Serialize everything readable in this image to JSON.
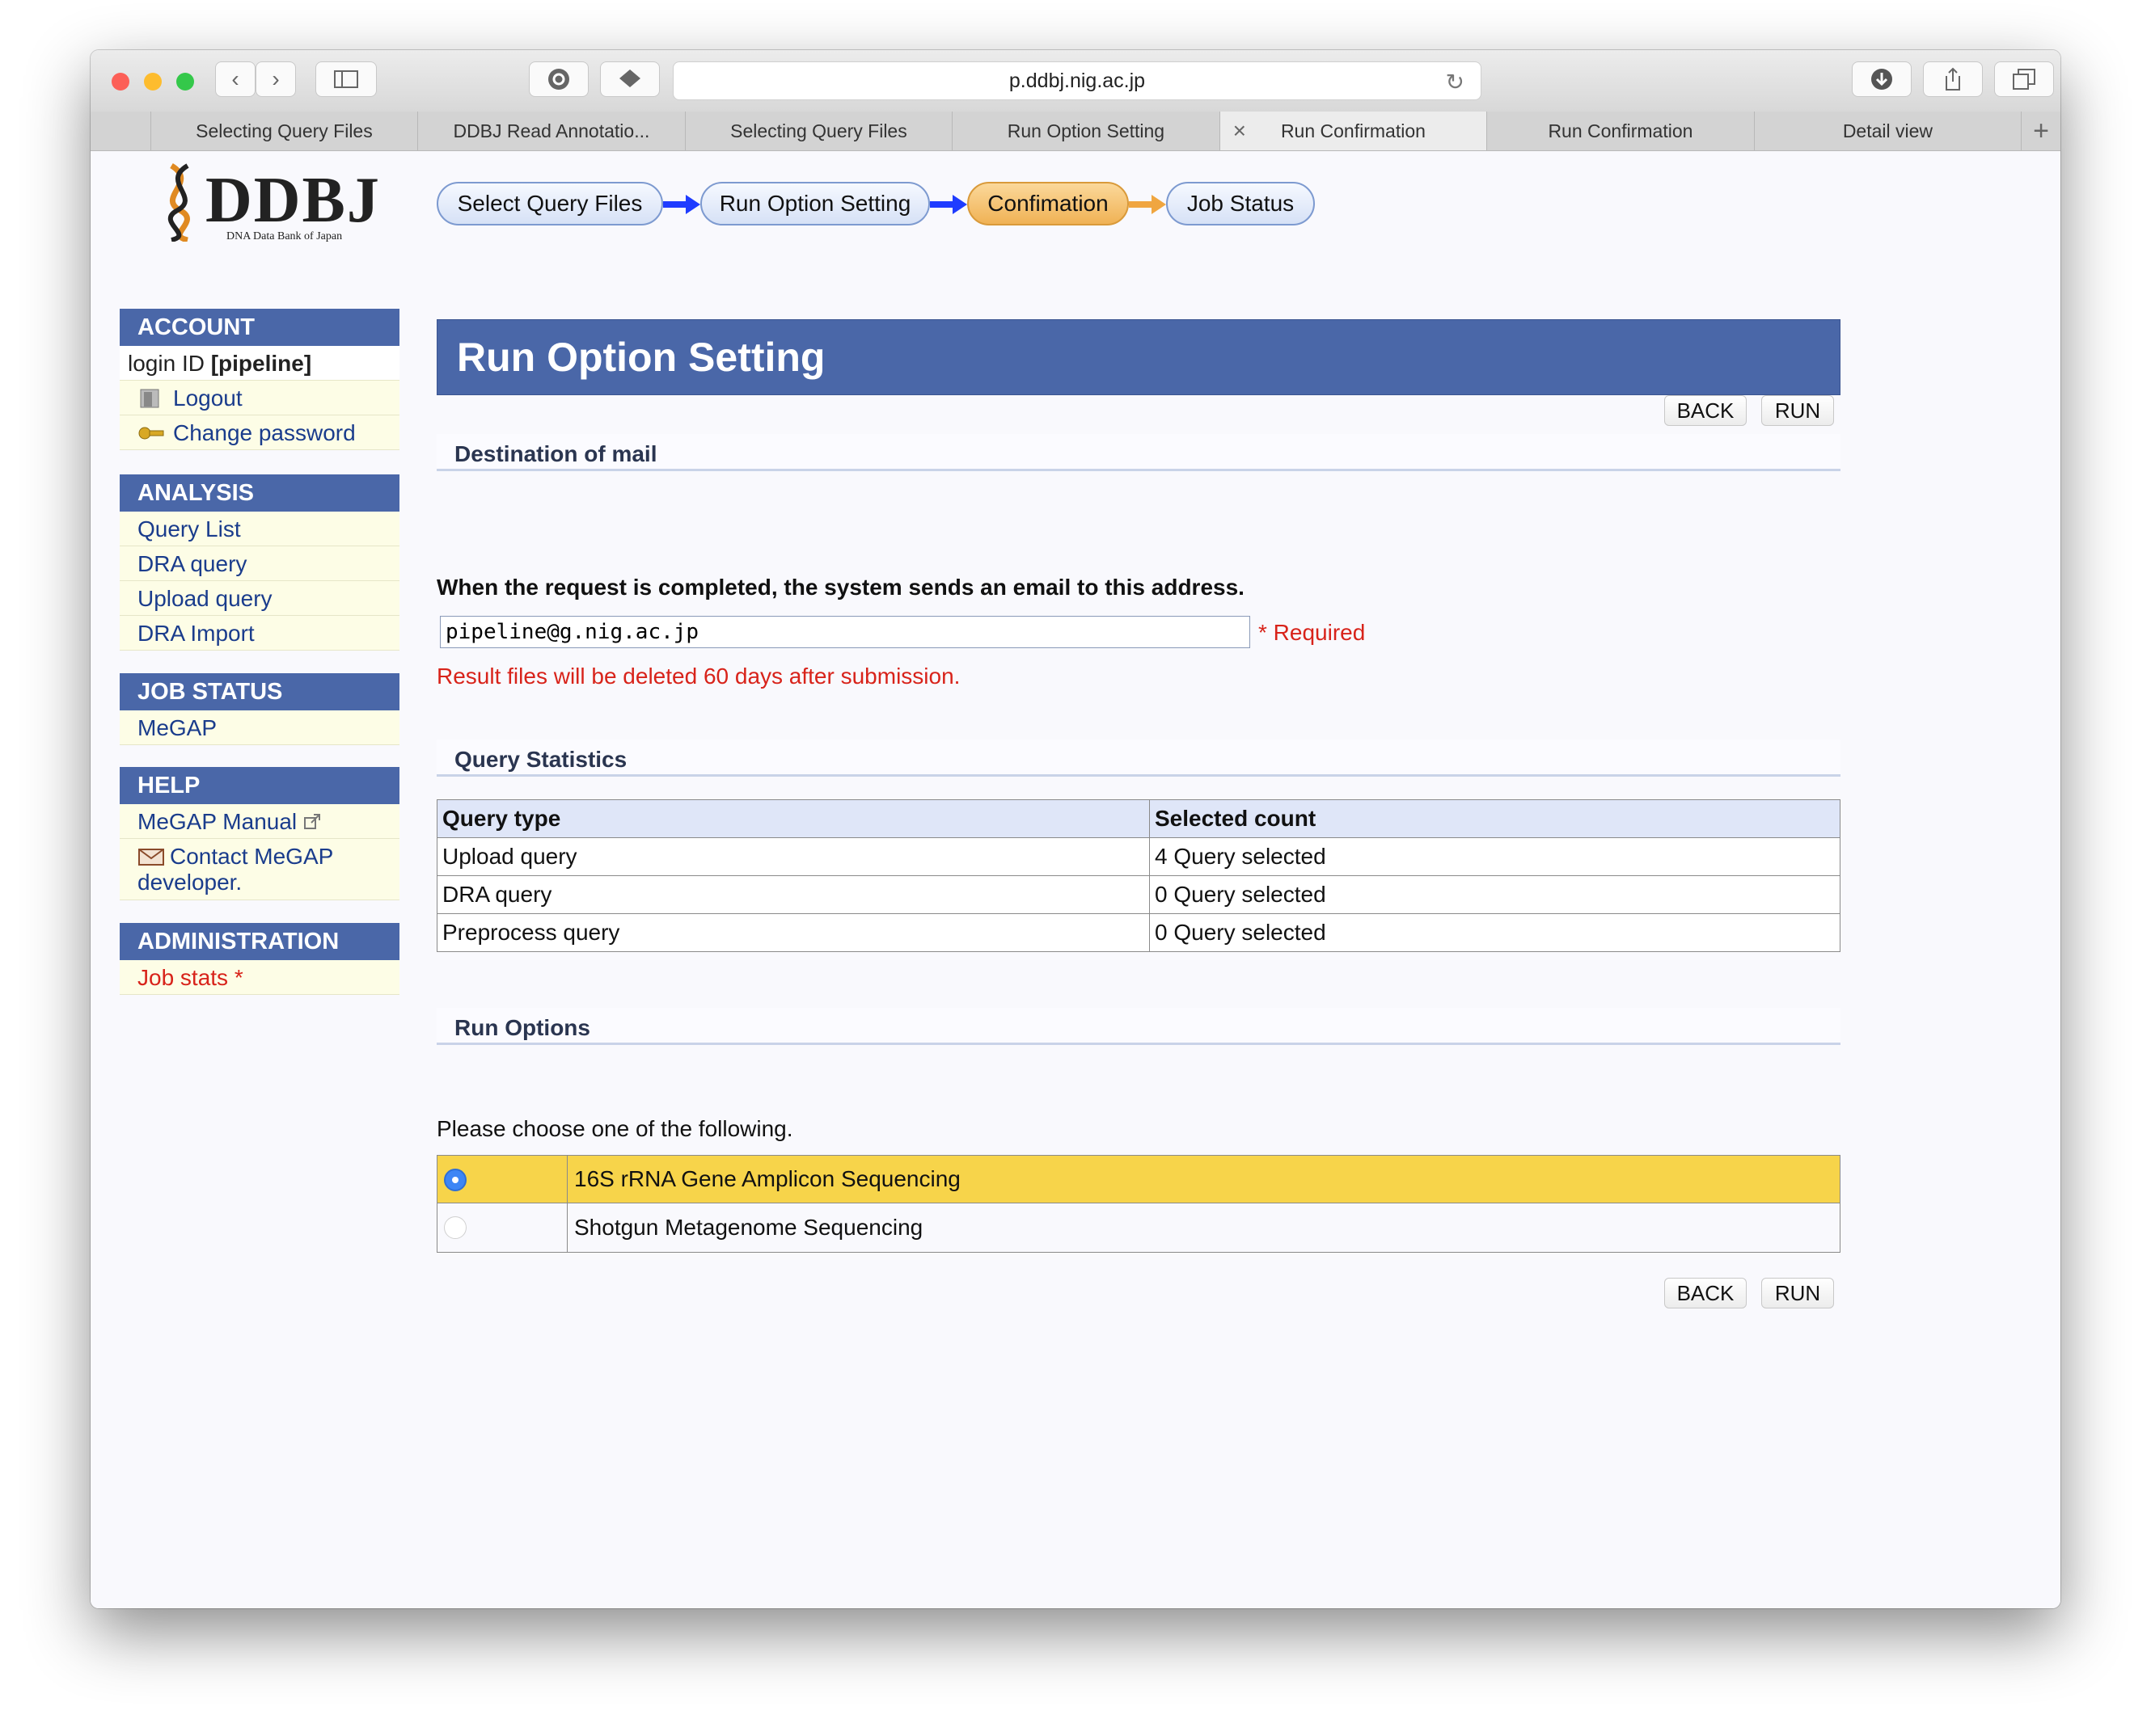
{
  "browser": {
    "url": "p.ddbj.nig.ac.jp",
    "tabs": [
      {
        "label": "Selecting Query Files",
        "active": false
      },
      {
        "label": "DDBJ Read Annotatio...",
        "active": false
      },
      {
        "label": "Selecting Query Files",
        "active": false
      },
      {
        "label": "Run Option Setting",
        "active": false
      },
      {
        "label": "Run Confirmation",
        "active": true
      },
      {
        "label": "Run Confirmation",
        "active": false
      },
      {
        "label": "Detail view",
        "active": false
      }
    ]
  },
  "logo": {
    "text": "DDBJ",
    "subtitle": "DNA Data Bank of Japan"
  },
  "sidebar": {
    "account": {
      "heading": "ACCOUNT",
      "login_prefix": "login ID ",
      "login_id": "[pipeline]",
      "logout": "Logout",
      "change_password": "Change password"
    },
    "analysis": {
      "heading": "ANALYSIS",
      "items": [
        "Query List",
        "DRA query",
        "Upload query",
        "DRA Import"
      ]
    },
    "job_status": {
      "heading": "JOB STATUS",
      "items": [
        "MeGAP"
      ]
    },
    "help": {
      "heading": "HELP",
      "manual": "MeGAP Manual",
      "contact_line1": "Contact MeGAP",
      "contact_line2": "developer."
    },
    "administration": {
      "heading": "ADMINISTRATION",
      "job_stats": "Job stats *"
    }
  },
  "steps": [
    "Select Query Files",
    "Run Option Setting",
    "Confimation",
    "Job Status"
  ],
  "main": {
    "title": "Run Option Setting",
    "back_label": "BACK",
    "run_label": "RUN",
    "mail": {
      "heading": "Destination of mail",
      "description": "When the request is completed, the system sends an email to this address.",
      "email": "pipeline@g.nig.ac.jp",
      "required": "* Required",
      "notice": "Result files will be deleted 60 days after submission."
    },
    "stats": {
      "heading": "Query Statistics",
      "columns": [
        "Query type",
        "Selected count"
      ],
      "rows": [
        [
          "Upload query",
          "4 Query selected"
        ],
        [
          "DRA query",
          "0 Query selected"
        ],
        [
          "Preprocess query",
          "0 Query selected"
        ]
      ]
    },
    "run_options": {
      "heading": "Run Options",
      "prompt": "Please choose one of the following.",
      "options": [
        "16S rRNA Gene Amplicon Sequencing",
        "Shotgun Metagenome Sequencing"
      ],
      "selected_index": 0
    }
  },
  "colors": {
    "header_blue": "#4a67a8",
    "link_blue": "#1a3c8c",
    "warning_red": "#d8231a",
    "selected_row": "#f7d44a",
    "active_step": "#f0b255"
  }
}
